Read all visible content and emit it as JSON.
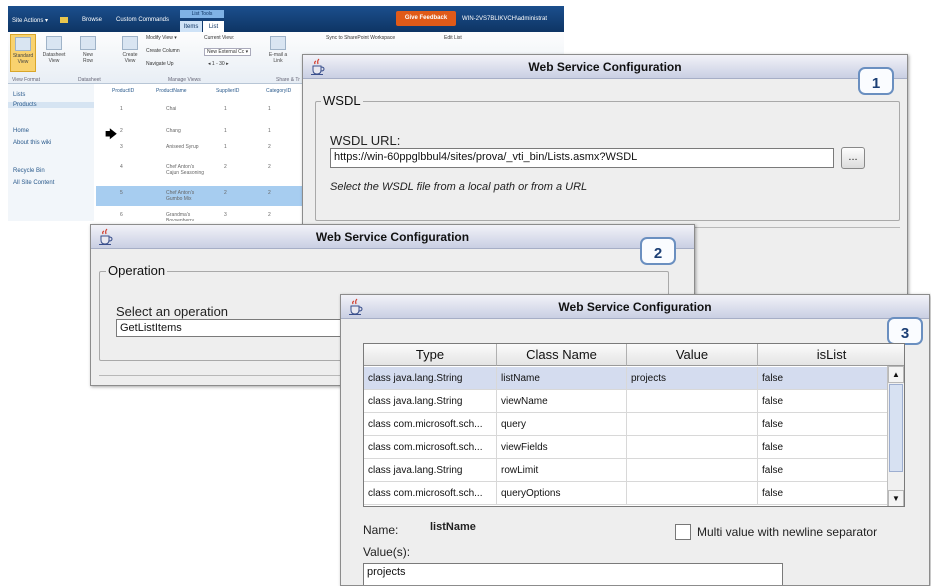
{
  "sharepoint": {
    "site_actions": "Site Actions ▾",
    "browse": "Browse",
    "custom_commands": "Custom Commands",
    "list_tools": "List Tools",
    "tab_items": "Items",
    "tab_list": "List",
    "give_feedback": "Give Feedback",
    "user": "WIN-2VS7BLIKVCH\\administrat",
    "ribbon": {
      "standard_view": "Standard View",
      "datasheet_view": "Datasheet View",
      "new_row": "New Row",
      "create_view": "Create View",
      "modify_view": "Modify View ▾",
      "create_column": "Create Column",
      "navigate_up": "Navigate Up",
      "current_view_label": "Current View:",
      "current_view_value": "New External Cc ▾",
      "page_nav": "◂ 1 - 30 ▸",
      "email_link": "E-mail a Link",
      "sync_sharepoint": "Sync to SharePoint Workspace",
      "edit_list": "Edit List",
      "group_view_format": "View Format",
      "group_datasheet": "Datasheet",
      "group_manage_views": "Manage Views",
      "group_share": "Share & Tr"
    },
    "left_nav": [
      "Lists",
      "Products",
      "Home",
      "About this wiki",
      "Recycle Bin",
      "All Site Content"
    ],
    "list_headers": [
      "ProductID",
      "ProductName",
      "SupplierID",
      "CategoryID"
    ],
    "rows": [
      {
        "id": "1",
        "name": "Chai",
        "supplier": "1",
        "category": "1"
      },
      {
        "id": "2",
        "name": "Chang",
        "supplier": "1",
        "category": "1"
      },
      {
        "id": "3",
        "name": "Aniseed Syrup",
        "supplier": "1",
        "category": "2"
      },
      {
        "id": "4",
        "name": "Chef Anton's Cajun Seasoning",
        "supplier": "2",
        "category": "2"
      },
      {
        "id": "5",
        "name": "Chef Anton's Gumbo Mix",
        "supplier": "2",
        "category": "2"
      },
      {
        "id": "6",
        "name": "Grandma's Boysenberry",
        "supplier": "3",
        "category": "2"
      }
    ]
  },
  "dialog1": {
    "title": "Web Service Configuration",
    "badge": "1",
    "wsdl_legend": "WSDL",
    "wsdl_url_label": "WSDL URL:",
    "wsdl_url_value": "https://win-60ppglbbul4/sites/prova/_vti_bin/Lists.asmx?WSDL",
    "browse_button": "...",
    "hint": "Select the WSDL file from a local path or from a URL"
  },
  "dialog2": {
    "title": "Web Service Configuration",
    "badge": "2",
    "operation_legend": "Operation",
    "select_label": "Select an operation",
    "select_value": "GetListItems"
  },
  "dialog3": {
    "title": "Web Service Configuration",
    "badge": "3",
    "columns": [
      "Type",
      "Class Name",
      "Value",
      "isList"
    ],
    "rows": [
      {
        "type": "class java.lang.String",
        "class_name": "listName",
        "value": "projects",
        "is_list": "false"
      },
      {
        "type": "class java.lang.String",
        "class_name": "viewName",
        "value": "",
        "is_list": "false"
      },
      {
        "type": "class com.microsoft.sch...",
        "class_name": "query",
        "value": "",
        "is_list": "false"
      },
      {
        "type": "class com.microsoft.sch...",
        "class_name": "viewFields",
        "value": "",
        "is_list": "false"
      },
      {
        "type": "class java.lang.String",
        "class_name": "rowLimit",
        "value": "",
        "is_list": "false"
      },
      {
        "type": "class com.microsoft.sch...",
        "class_name": "queryOptions",
        "value": "",
        "is_list": "false"
      }
    ],
    "name_label": "Name:",
    "name_value": "listName",
    "multi_value_label": "Multi value with newline separator",
    "values_label": "Value(s):",
    "values_value": "projects"
  },
  "icons": [
    "java-cup-icon",
    "scroll-up-icon",
    "scroll-down-icon",
    "mouse-pointer-icon"
  ]
}
